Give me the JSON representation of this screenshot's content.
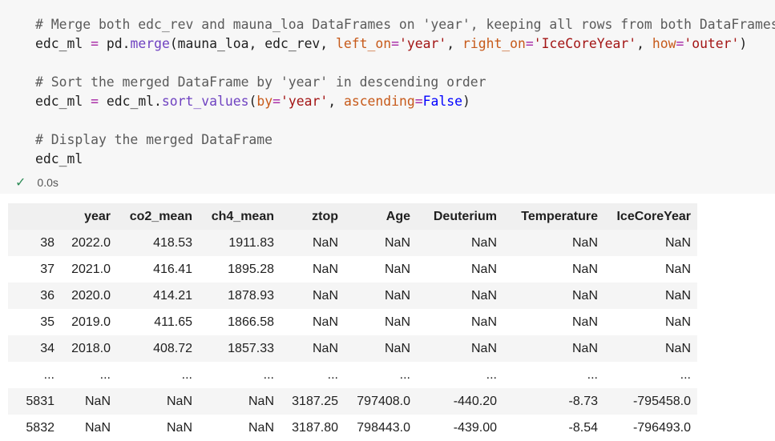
{
  "code": {
    "comment1": "# Merge both edc_rev and mauna_loa DataFrames on 'year', keeping all rows from both DataFrames",
    "line2": {
      "var": "edc_ml",
      "eq": "=",
      "mod": "pd",
      "dot": ".",
      "fn": "merge",
      "open": "(mauna_loa, edc_rev, ",
      "k1": "left_on",
      "v1": "'year'",
      "sep1": ", ",
      "k2": "right_on",
      "v2": "'IceCoreYear'",
      "sep2": ", ",
      "k3": "how",
      "v3": "'outer'",
      "close": ")"
    },
    "comment2": "# Sort the merged DataFrame by 'year' in descending order",
    "line4": {
      "var": "edc_ml",
      "eq": "=",
      "obj": "edc_ml.",
      "fn": "sort_values",
      "open": "(",
      "k1": "by",
      "v1": "'year'",
      "sep": ", ",
      "k2": "ascending",
      "v2": "False",
      "close": ")"
    },
    "comment3": "# Display the merged DataFrame",
    "line6": "edc_ml"
  },
  "status": {
    "icon": "check-icon",
    "duration": "0.0s"
  },
  "table": {
    "headers": [
      "",
      "year",
      "co2_mean",
      "ch4_mean",
      "ztop",
      "Age",
      "Deuterium",
      "Temperature",
      "IceCoreYear"
    ],
    "rows": [
      [
        "38",
        "2022.0",
        "418.53",
        "1911.83",
        "NaN",
        "NaN",
        "NaN",
        "NaN",
        "NaN"
      ],
      [
        "37",
        "2021.0",
        "416.41",
        "1895.28",
        "NaN",
        "NaN",
        "NaN",
        "NaN",
        "NaN"
      ],
      [
        "36",
        "2020.0",
        "414.21",
        "1878.93",
        "NaN",
        "NaN",
        "NaN",
        "NaN",
        "NaN"
      ],
      [
        "35",
        "2019.0",
        "411.65",
        "1866.58",
        "NaN",
        "NaN",
        "NaN",
        "NaN",
        "NaN"
      ],
      [
        "34",
        "2018.0",
        "408.72",
        "1857.33",
        "NaN",
        "NaN",
        "NaN",
        "NaN",
        "NaN"
      ],
      [
        "...",
        "...",
        "...",
        "...",
        "...",
        "...",
        "...",
        "...",
        "..."
      ],
      [
        "5831",
        "NaN",
        "NaN",
        "NaN",
        "3187.25",
        "797408.0",
        "-440.20",
        "-8.73",
        "-795458.0"
      ],
      [
        "5832",
        "NaN",
        "NaN",
        "NaN",
        "3187.80",
        "798443.0",
        "-439.00",
        "-8.54",
        "-796493.0"
      ]
    ]
  }
}
